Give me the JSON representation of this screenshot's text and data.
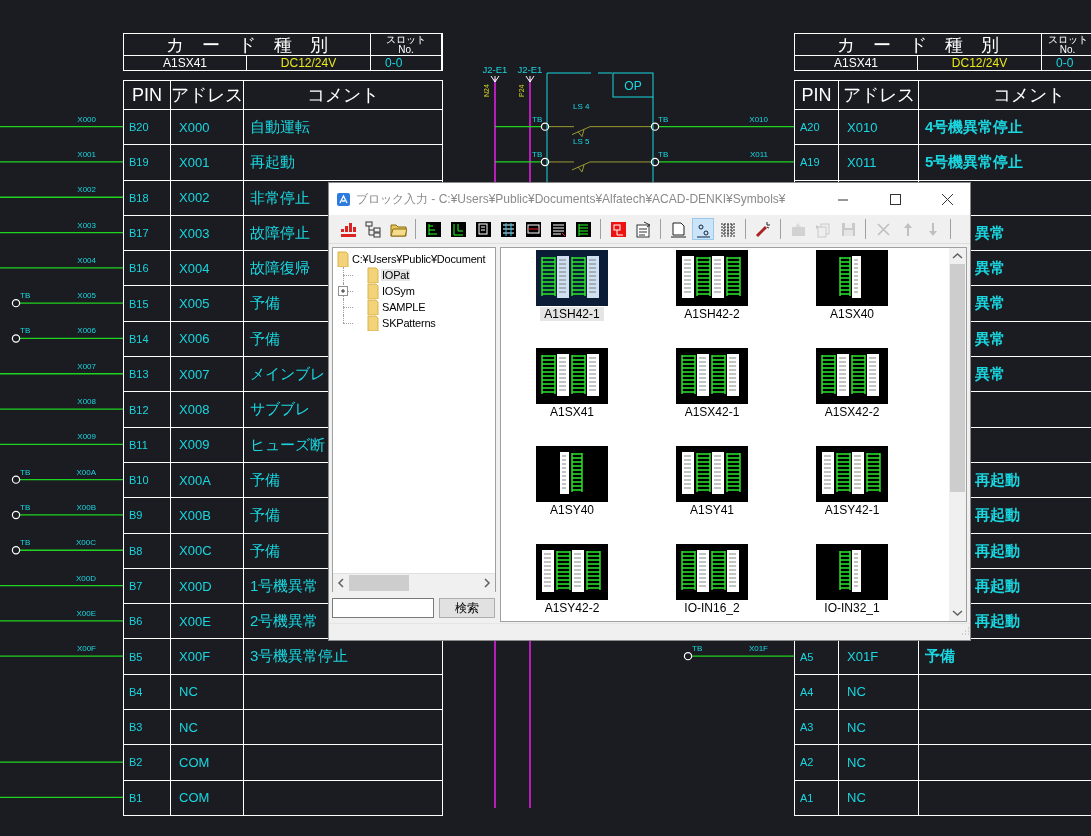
{
  "left_card": {
    "title": "カード種別",
    "slot_label": "スロット",
    "slot_no_label": "No.",
    "model": "A1SX41",
    "voltage": "DC12/24V",
    "slot": "0-0"
  },
  "left_table": {
    "columns": [
      "PIN",
      "アドレス",
      "コメント"
    ],
    "rows": [
      {
        "pin": "B20",
        "address": "X000",
        "comment": "自動運転",
        "wire": {
          "kind": "plain",
          "label": "X000"
        }
      },
      {
        "pin": "B19",
        "address": "X001",
        "comment": "再起動",
        "wire": {
          "kind": "plain",
          "label": "X001"
        }
      },
      {
        "pin": "B18",
        "address": "X002",
        "comment": "非常停止",
        "wire": {
          "kind": "plain",
          "label": "X002"
        }
      },
      {
        "pin": "B17",
        "address": "X003",
        "comment": "故障停止",
        "wire": {
          "kind": "plain",
          "label": "X003"
        }
      },
      {
        "pin": "B16",
        "address": "X004",
        "comment": "故障復帰",
        "wire": {
          "kind": "plain",
          "label": "X004"
        }
      },
      {
        "pin": "B15",
        "address": "X005",
        "comment": "予備",
        "wire": {
          "kind": "terminal",
          "label": "X005",
          "terminal_label": "TB"
        }
      },
      {
        "pin": "B14",
        "address": "X006",
        "comment": "予備",
        "wire": {
          "kind": "terminal",
          "label": "X006",
          "terminal_label": "TB"
        }
      },
      {
        "pin": "B13",
        "address": "X007",
        "comment": "メインブレ",
        "wire": {
          "kind": "plain",
          "label": "X007"
        }
      },
      {
        "pin": "B12",
        "address": "X008",
        "comment": "サブブレ",
        "wire": {
          "kind": "plain",
          "label": "X008"
        }
      },
      {
        "pin": "B11",
        "address": "X009",
        "comment": "ヒューズ断",
        "wire": {
          "kind": "plain",
          "label": "X009"
        }
      },
      {
        "pin": "B10",
        "address": "X00A",
        "comment": "予備",
        "wire": {
          "kind": "terminal",
          "label": "X00A",
          "terminal_label": "TB"
        }
      },
      {
        "pin": "B9",
        "address": "X00B",
        "comment": "予備",
        "wire": {
          "kind": "terminal",
          "label": "X00B",
          "terminal_label": "TB"
        }
      },
      {
        "pin": "B8",
        "address": "X00C",
        "comment": "予備",
        "wire": {
          "kind": "terminal",
          "label": "X00C",
          "terminal_label": "TB"
        }
      },
      {
        "pin": "B7",
        "address": "X00D",
        "comment": "1号機異常",
        "wire": {
          "kind": "plain",
          "label": "X00D"
        }
      },
      {
        "pin": "B6",
        "address": "X00E",
        "comment": "2号機異常",
        "wire": {
          "kind": "plain",
          "label": "X00E"
        }
      },
      {
        "pin": "B5",
        "address": "X00F",
        "comment": "3号機異常停止",
        "wire": {
          "kind": "plain",
          "label": "X00F"
        }
      },
      {
        "pin": "B4",
        "address": "NC"
      },
      {
        "pin": "B3",
        "address": "NC"
      },
      {
        "pin": "B2",
        "address": "COM",
        "wire": {
          "kind": "plain"
        }
      },
      {
        "pin": "B1",
        "address": "COM",
        "wire": {
          "kind": "plain"
        }
      }
    ]
  },
  "schematic": {
    "rails": [
      {
        "label": "J2-E1",
        "voltage": "N24"
      },
      {
        "label": "J2-E1",
        "voltage": "P24"
      }
    ],
    "box_label": "OP",
    "switches": [
      {
        "label": "LS 4",
        "left_terminal": "TB",
        "right_terminal": "TB"
      },
      {
        "label": "LS 5",
        "left_terminal": "TB",
        "right_terminal": "TB"
      }
    ]
  },
  "right_card": {
    "title": "カード種別",
    "slot_label": "スロット",
    "slot_no_label": "No.",
    "model": "A1SX41",
    "voltage": "DC12/24V",
    "slot": "0-0"
  },
  "right_table": {
    "columns": [
      "PIN",
      "アドレス",
      "コメント"
    ],
    "rows": [
      {
        "pin": "A20",
        "address": "X010",
        "comment": "4号機異常停止",
        "wire": {
          "kind": "plain",
          "label": "X010"
        }
      },
      {
        "pin": "A19",
        "address": "X011",
        "comment": "5号機異常停止",
        "wire": {
          "kind": "plain",
          "label": "X011"
        }
      },
      {},
      {
        "comment": "異常"
      },
      {
        "comment": "異常"
      },
      {
        "comment": "異常"
      },
      {
        "comment": "異常"
      },
      {
        "comment": "異常"
      },
      {},
      {},
      {
        "comment": "再起動"
      },
      {
        "comment": "再起動"
      },
      {
        "comment": "再起動"
      },
      {
        "comment": "再起動"
      },
      {
        "comment": "再起動"
      },
      {
        "pin": "A5",
        "address": "X01F",
        "comment": "予備",
        "wire": {
          "kind": "terminal",
          "label": "X01F",
          "terminal_label": "TB"
        }
      },
      {
        "pin": "A4",
        "address": "NC"
      },
      {
        "pin": "A3",
        "address": "NC"
      },
      {
        "pin": "A2",
        "address": "NC"
      },
      {
        "pin": "A1",
        "address": "NC"
      }
    ]
  },
  "dialog": {
    "title": "ブロック入力 - C:¥Users¥Public¥Documents¥Alfatech¥ACAD-DENKI¥Symbols¥",
    "toolbar": [
      {
        "kind": "button",
        "disabled": false,
        "selected": false
      },
      {
        "kind": "button",
        "disabled": false,
        "selected": false
      },
      {
        "kind": "button",
        "disabled": false,
        "selected": false
      },
      {
        "kind": "separator"
      },
      {
        "kind": "button",
        "disabled": false,
        "selected": false
      },
      {
        "kind": "button",
        "disabled": false,
        "selected": false
      },
      {
        "kind": "button",
        "disabled": false,
        "selected": false
      },
      {
        "kind": "button",
        "disabled": false,
        "selected": false
      },
      {
        "kind": "button",
        "disabled": false,
        "selected": false
      },
      {
        "kind": "button",
        "disabled": false,
        "selected": false
      },
      {
        "kind": "button",
        "disabled": false,
        "selected": false
      },
      {
        "kind": "separator"
      },
      {
        "kind": "button",
        "disabled": false,
        "selected": false
      },
      {
        "kind": "button",
        "disabled": false,
        "selected": false
      },
      {
        "kind": "separator"
      },
      {
        "kind": "button",
        "disabled": false,
        "selected": false
      },
      {
        "kind": "button",
        "disabled": false,
        "selected": true
      },
      {
        "kind": "button",
        "disabled": false,
        "selected": false
      },
      {
        "kind": "separator"
      },
      {
        "kind": "button",
        "disabled": false,
        "selected": false
      },
      {
        "kind": "separator"
      },
      {
        "kind": "button",
        "disabled": true,
        "selected": false
      },
      {
        "kind": "button",
        "disabled": true,
        "selected": false
      },
      {
        "kind": "button",
        "disabled": true,
        "selected": false
      },
      {
        "kind": "separator"
      },
      {
        "kind": "button",
        "disabled": true,
        "selected": false
      },
      {
        "kind": "button",
        "disabled": true,
        "selected": false
      },
      {
        "kind": "button",
        "disabled": true,
        "selected": false
      },
      {
        "kind": "separator"
      }
    ],
    "tree": {
      "label": "C:¥Users¥Public¥Document",
      "children": [
        {
          "label": "IOPat",
          "selected": true,
          "expandable": false
        },
        {
          "label": "IOSym",
          "selected": false,
          "expandable": true
        },
        {
          "label": "SAMPLE",
          "selected": false,
          "expandable": false
        },
        {
          "label": "SKPatterns",
          "selected": false,
          "expandable": false
        }
      ]
    },
    "search": {
      "button": "検索"
    },
    "symbols": [
      {
        "label": "A1SH42-1",
        "selected": true
      },
      {
        "label": "A1SH42-2",
        "selected": false
      },
      {
        "label": "A1SX40",
        "selected": false
      },
      {
        "label": "A1SX41",
        "selected": false
      },
      {
        "label": "A1SX42-1",
        "selected": false
      },
      {
        "label": "A1SX42-2",
        "selected": false
      },
      {
        "label": "A1SY40",
        "selected": false
      },
      {
        "label": "A1SY41",
        "selected": false
      },
      {
        "label": "A1SY42-1",
        "selected": false
      },
      {
        "label": "A1SY42-2",
        "selected": false
      },
      {
        "label": "IO-IN16_2",
        "selected": false
      },
      {
        "label": "IO-IN32_1",
        "selected": false
      }
    ]
  }
}
